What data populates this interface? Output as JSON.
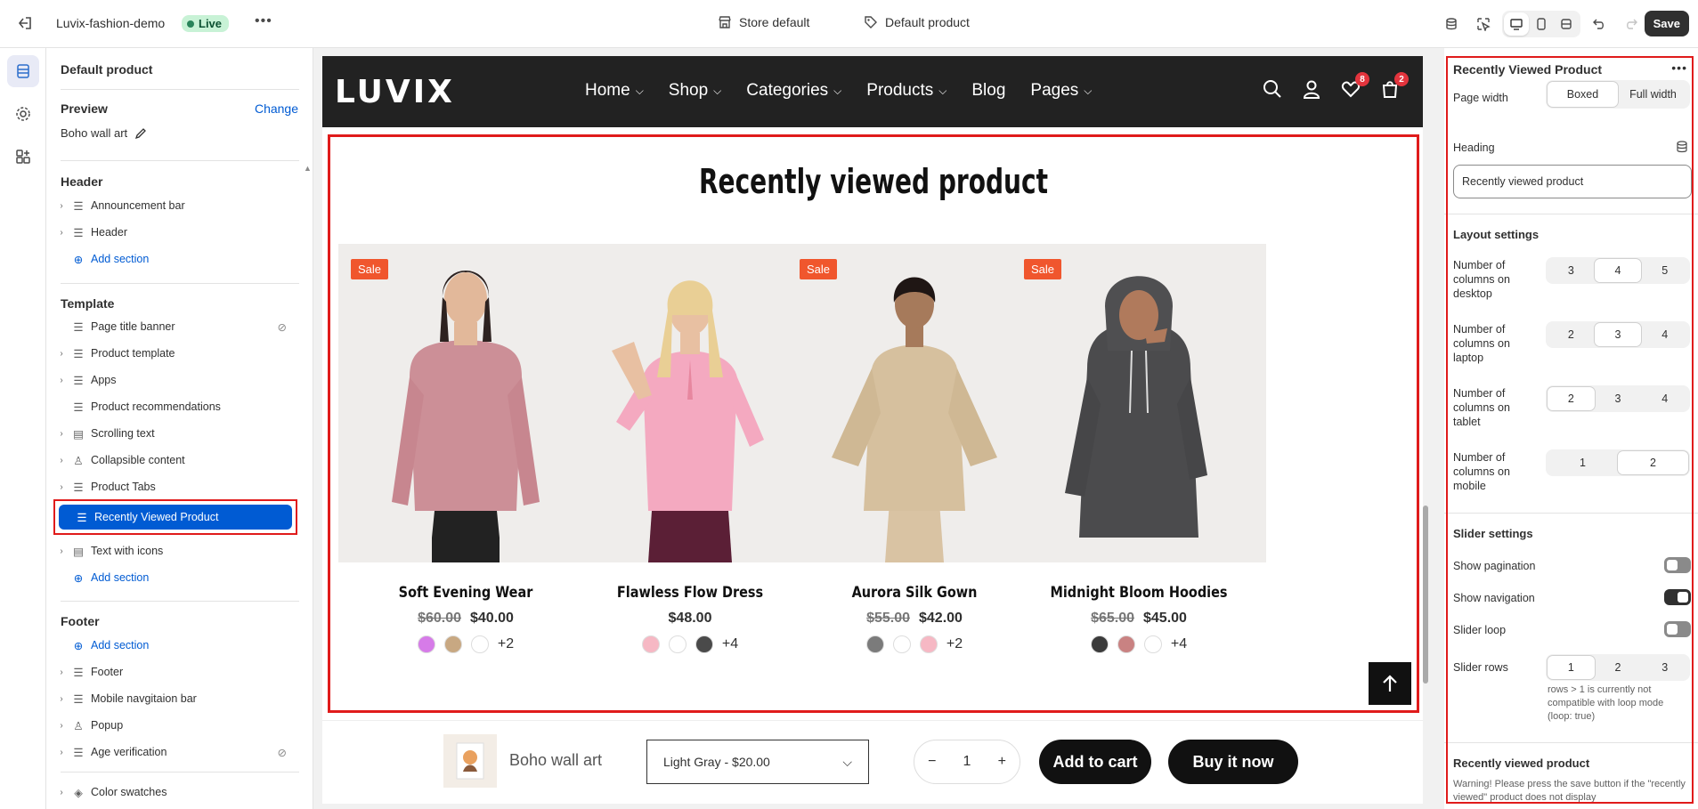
{
  "topbar": {
    "store_name": "Luvix-fashion-demo",
    "status": "Live",
    "theme_label": "Store default",
    "template_label": "Default product",
    "save_label": "Save"
  },
  "left_panel": {
    "title": "Default product",
    "preview_label": "Preview",
    "change_label": "Change",
    "preview_value": "Boho wall art",
    "header_group": "Header",
    "header_items": [
      "Announcement bar",
      "Header"
    ],
    "add_section": "Add section",
    "template_group": "Template",
    "template_items": [
      "Page title banner",
      "Product template",
      "Apps",
      "Product recommendations",
      "Scrolling text",
      "Collapsible content",
      "Product Tabs",
      "Recently Viewed Product",
      "Text with icons"
    ],
    "footer_group": "Footer",
    "footer_items": [
      "Footer",
      "Mobile navgitaion bar",
      "Popup",
      "Age verification"
    ],
    "extra_item": "Color swatches"
  },
  "store": {
    "logo": "LUVIX",
    "nav": [
      "Home",
      "Shop",
      "Categories",
      "Products",
      "Blog",
      "Pages"
    ],
    "wishlist_count": "8",
    "cart_count": "2",
    "section_heading": "Recently viewed product",
    "products": [
      {
        "name": "Soft Evening Wear",
        "old_price": "$60.00",
        "price": "$40.00",
        "sale": "Sale",
        "more": "+2",
        "swatches": [
          "#d67be8",
          "#c8a882",
          "#ffffff"
        ]
      },
      {
        "name": "Flawless Flow Dress",
        "old_price": "",
        "price": "$48.00",
        "sale": "",
        "more": "+4",
        "swatches": [
          "#f6b8c4",
          "#ffffff",
          "#4a4a4a"
        ]
      },
      {
        "name": "Aurora Silk Gown",
        "old_price": "$55.00",
        "price": "$42.00",
        "sale": "Sale",
        "more": "+2",
        "swatches": [
          "#7b7b7b",
          "#ffffff",
          "#f6b8c4"
        ]
      },
      {
        "name": "Midnight Bloom Hoodies",
        "old_price": "$65.00",
        "price": "$45.00",
        "sale": "Sale",
        "more": "+4",
        "swatches": [
          "#3b3b3b",
          "#c98282",
          "#ffffff"
        ]
      }
    ],
    "sticky": {
      "name": "Boho wall art",
      "variant": "Light Gray - $20.00",
      "qty": "1",
      "add_to_cart": "Add to cart",
      "buy_now": "Buy it now"
    }
  },
  "right_panel": {
    "title": "Recently Viewed Product",
    "page_width_label": "Page width",
    "page_width_options": [
      "Boxed",
      "Full width"
    ],
    "heading_label": "Heading",
    "heading_value": "Recently viewed product",
    "layout_heading": "Layout settings",
    "cols_desktop_label": "Number of columns on desktop",
    "cols_desktop": [
      "3",
      "4",
      "5"
    ],
    "cols_laptop_label": "Number of columns on laptop",
    "cols_laptop": [
      "2",
      "3",
      "4"
    ],
    "cols_tablet_label": "Number of columns on tablet",
    "cols_tablet": [
      "2",
      "3",
      "4"
    ],
    "cols_mobile_label": "Number of columns on mobile",
    "cols_mobile": [
      "1",
      "2"
    ],
    "slider_heading": "Slider settings",
    "show_pagination": "Show pagination",
    "show_navigation": "Show navigation",
    "slider_loop": "Slider loop",
    "slider_rows_label": "Slider rows",
    "slider_rows": [
      "1",
      "2",
      "3"
    ],
    "rows_note": "rows > 1 is currently not compatible with loop mode (loop: true)",
    "rv_heading": "Recently viewed product",
    "warning": "Warning! Please press the save button if the \"recently viewed\" product does not display"
  }
}
